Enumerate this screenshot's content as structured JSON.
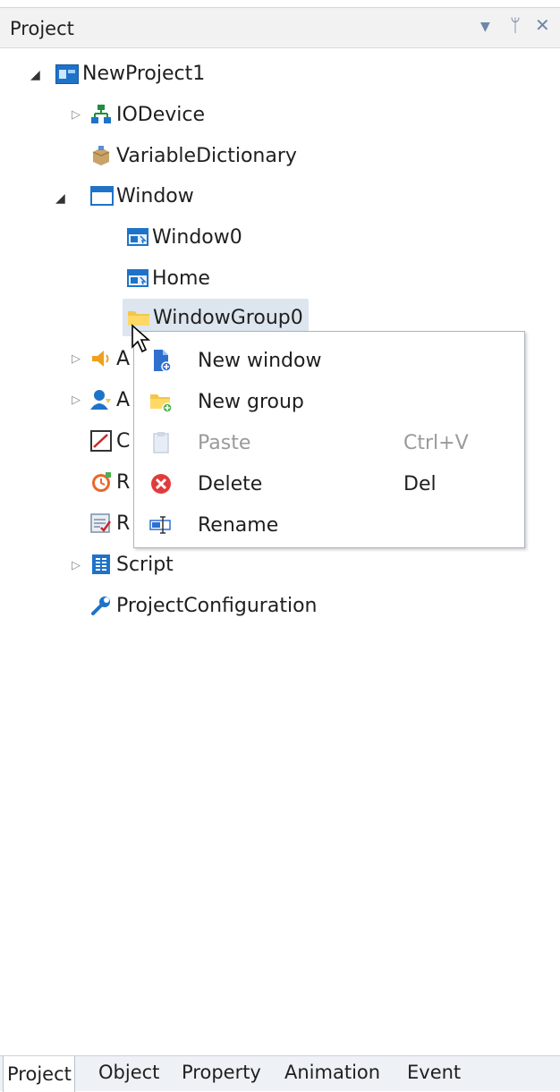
{
  "panel": {
    "title": "Project"
  },
  "tree": {
    "project": "NewProject1",
    "io_device": "IODevice",
    "variable_dictionary": "VariableDictionary",
    "window": "Window",
    "window0": "Window0",
    "home": "Home",
    "window_group0": "WindowGroup0",
    "alarm_partial": "A",
    "user_partial": "A",
    "curve_partial": "C",
    "recipe_partial": "R",
    "report_partial": "R",
    "script": "Script",
    "project_configuration": "ProjectConfiguration"
  },
  "context_menu": {
    "items": [
      {
        "label": "New window",
        "shortcut": "",
        "icon": "new-window-icon"
      },
      {
        "label": "New group",
        "shortcut": "",
        "icon": "new-group-icon"
      },
      {
        "label": "Paste",
        "shortcut": "Ctrl+V",
        "icon": "paste-icon",
        "disabled": true
      },
      {
        "label": "Delete",
        "shortcut": "Del",
        "icon": "delete-icon"
      },
      {
        "label": "Rename",
        "shortcut": "",
        "icon": "rename-icon"
      }
    ]
  },
  "tabs": [
    "Project",
    "Object",
    "Property",
    "Animation",
    "Event"
  ],
  "colors": {
    "accent_blue": "#1e73c9",
    "selection": "#dde6ef",
    "delete_red": "#e23b3b"
  }
}
